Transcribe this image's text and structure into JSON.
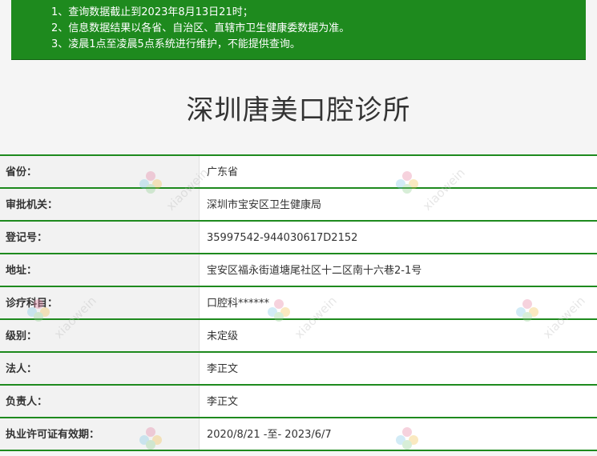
{
  "notice": {
    "lines": [
      "1、查询数据截止到2023年8月13日21时；",
      "2、信息数据结果以各省、自治区、直辖市卫生健康委数据为准。",
      "3、凌晨1点至凌晨5点系统进行维护，不能提供查询。"
    ]
  },
  "title": "深圳唐美口腔诊所",
  "rows": [
    {
      "label": "省份：",
      "value": "广东省"
    },
    {
      "label": "审批机关：",
      "value": "深圳市宝安区卫生健康局"
    },
    {
      "label": "登记号：",
      "value": "35997542-944030617D2152"
    },
    {
      "label": "地址：",
      "value": "宝安区福永街道塘尾社区十二区南十六巷2-1号"
    },
    {
      "label": "诊疗科目：",
      "value": "口腔科******"
    },
    {
      "label": "级别：",
      "value": "未定级"
    },
    {
      "label": "法人：",
      "value": "李正文"
    },
    {
      "label": "负责人：",
      "value": "李正文"
    },
    {
      "label": "执业许可证有效期：",
      "value": "2020/8/21 -至- 2023/6/7"
    }
  ],
  "watermark": {
    "text": "xiaowein",
    "logo": "flower-logo-icon"
  }
}
